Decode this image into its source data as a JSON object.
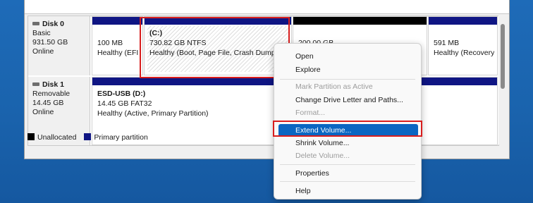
{
  "disks": [
    {
      "name": "Disk 0",
      "type": "Basic",
      "size": "931.50 GB",
      "status": "Online",
      "partitions": [
        {
          "title": "",
          "size": "100 MB",
          "status": "Healthy (EFI S"
        },
        {
          "title": "(C:)",
          "size": "730.82 GB NTFS",
          "status": "Healthy (Boot, Page File, Crash Dump, Bas"
        },
        {
          "title": "",
          "size": "200.00 GB",
          "status": ""
        },
        {
          "title": "",
          "size": "591 MB",
          "status": "Healthy (Recovery P"
        }
      ]
    },
    {
      "name": "Disk 1",
      "type": "Removable",
      "size": "14.45 GB",
      "status": "Online",
      "partitions": [
        {
          "title": "ESD-USB  (D:)",
          "size": "14.45 GB FAT32",
          "status": "Healthy (Active, Primary Partition)"
        }
      ]
    }
  ],
  "legend": [
    {
      "label": "Unallocated",
      "color": "#000000"
    },
    {
      "label": "Primary partition",
      "color": "#0f1583"
    }
  ],
  "context_menu": {
    "items": [
      {
        "label": "Open",
        "enabled": true
      },
      {
        "label": "Explore",
        "enabled": true
      },
      {
        "label": "Mark Partition as Active",
        "enabled": false
      },
      {
        "label": "Change Drive Letter and Paths...",
        "enabled": true
      },
      {
        "label": "Format...",
        "enabled": false
      },
      {
        "label": "Extend Volume...",
        "enabled": true,
        "highlighted": true
      },
      {
        "label": "Shrink Volume...",
        "enabled": true
      },
      {
        "label": "Delete Volume...",
        "enabled": false
      },
      {
        "label": "Properties",
        "enabled": true
      },
      {
        "label": "Help",
        "enabled": true
      }
    ]
  },
  "colors": {
    "primary_partition": "#0f1583",
    "unallocated": "#000000",
    "highlight": "#0a66c2",
    "annotation_box": "#d81e1e"
  }
}
